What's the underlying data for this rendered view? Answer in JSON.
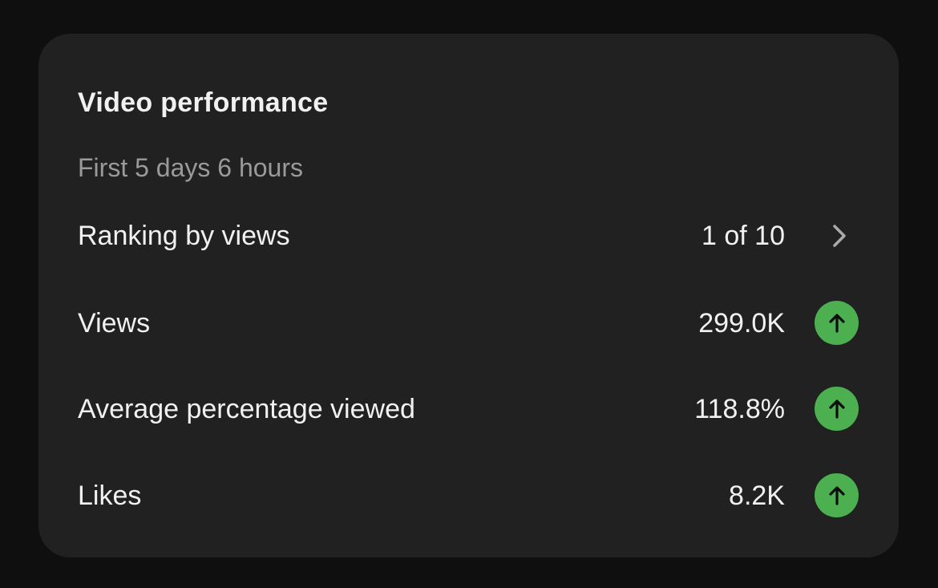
{
  "card": {
    "title": "Video performance",
    "subtitle": "First 5 days 6 hours"
  },
  "metrics": [
    {
      "label": "Ranking by views",
      "value": "1 of 10",
      "indicator": "chevron-right-icon"
    },
    {
      "label": "Views",
      "value": "299.0K",
      "indicator": "arrow-up-icon",
      "trend": "up"
    },
    {
      "label": "Average percentage viewed",
      "value": "118.8%",
      "indicator": "arrow-up-icon",
      "trend": "up"
    },
    {
      "label": "Likes",
      "value": "8.2K",
      "indicator": "arrow-up-icon",
      "trend": "up"
    }
  ],
  "colors": {
    "background": "#0f0f0f",
    "card": "#212121",
    "text": "#f1f1f1",
    "muted_text": "#9a9a9a",
    "trend_up": "#4caf50"
  }
}
